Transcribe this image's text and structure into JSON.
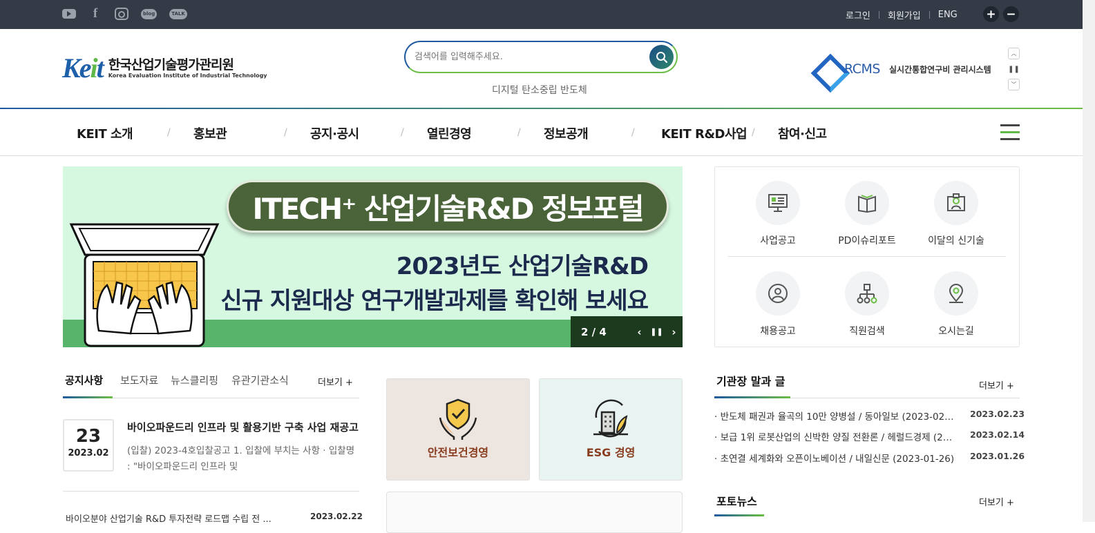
{
  "topbar": {
    "sns": [
      "youtube-icon",
      "facebook-icon",
      "instagram-icon",
      "blog-icon",
      "talk-icon"
    ],
    "sns_blog": "blog",
    "sns_talk": "TALK",
    "login": "로그인",
    "join": "회원가입",
    "eng": "ENG",
    "zoom_in": "+",
    "zoom_out": "−"
  },
  "header": {
    "logo_mark": "Keit",
    "logo_ko": "한국산업기술평가관리원",
    "logo_en": "Korea Evaluation Institute of Industrial Technology",
    "search_placeholder": "검색어를 입력해주세요.",
    "keywords": "디지털 탄소중립 반도체",
    "rcms_name": "RCMS",
    "rcms_desc": "실시간통합연구비 관리시스템"
  },
  "gnb": [
    "KEIT 소개",
    "홍보관",
    "공지·공시",
    "열린경영",
    "정보공개",
    "KEIT R&D사업",
    "참여·신고"
  ],
  "banner": {
    "pill": "ITECH⁺ 산업기술R&D 정보포털",
    "line1": "2023년도 산업기술R&D",
    "line2": "신규 지원대상 연구개발과제를 확인해 보세요",
    "counter": "2 / 4",
    "prev": "‹",
    "pause": "❚❚",
    "next": "›"
  },
  "quick": [
    {
      "label": "사업공고",
      "icon": "board-icon"
    },
    {
      "label": "PD이슈리포트",
      "icon": "book-icon"
    },
    {
      "label": "이달의 신기술",
      "icon": "lightbulb-icon"
    },
    {
      "label": "채용공고",
      "icon": "person-icon"
    },
    {
      "label": "직원검색",
      "icon": "org-chart-icon"
    },
    {
      "label": "오시는길",
      "icon": "location-icon"
    }
  ],
  "notice": {
    "tabs": [
      "공지사항",
      "보도자료",
      "뉴스클리핑",
      "유관기관소식"
    ],
    "more": "더보기 +",
    "day": "23",
    "year_month": "2023.02",
    "title": "바이오파운드리 인프라 및 활용기반 구축 사업 재공고",
    "body": "(입찰) 2023-4호입찰공고 1. 입찰에 부치는 사항 · 입찰명 : \"바이오파운드리 인프라 및",
    "next_title": "바이오분야 산업기술 R&D 투자전략 로드맵 수립 전 ...",
    "next_date": "2023.02.22"
  },
  "cards": [
    {
      "label": "안전보건경영",
      "color": "#8a3c1f"
    },
    {
      "label": "ESG 경영",
      "color": "#8a3c1f"
    }
  ],
  "ceo": {
    "title": "기관장 말과 글",
    "more": "더보기 +",
    "items": [
      {
        "title": "반도체 패권과 율곡의 10만 양병설 / 동아일보 (2023-02-23)",
        "date": "2023.02.23"
      },
      {
        "title": "보급 1위 로봇산업의 신박한 양질 전환론 / 헤럴드경제 (2023-02-14)",
        "date": "2023.02.14"
      },
      {
        "title": "초연결 세계화와 오픈이노베이션 / 내일신문 (2023-01-26)",
        "date": "2023.01.26"
      }
    ]
  },
  "photo": {
    "title": "포토뉴스",
    "more": "더보기 +"
  },
  "colors": {
    "topbar": "#343b47",
    "brand_blue": "#1f5aa0",
    "brand_green": "#6cbe45",
    "banner_bg": "#d6f7e0",
    "banner_pill": "#4a6338"
  }
}
